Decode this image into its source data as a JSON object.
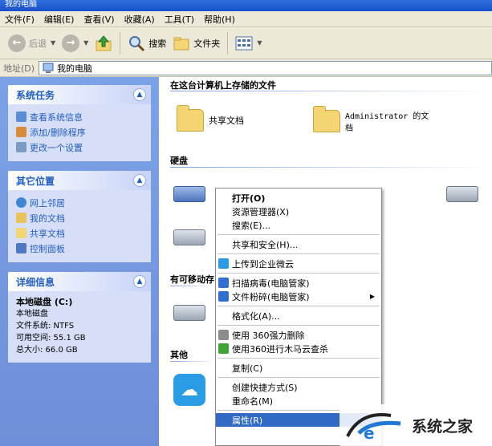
{
  "window": {
    "title": "我的电脑"
  },
  "menubar": [
    "文件(F)",
    "编辑(E)",
    "查看(V)",
    "收藏(A)",
    "工具(T)",
    "帮助(H)"
  ],
  "toolbar": {
    "back": "后退",
    "search": "搜索",
    "folders": "文件夹"
  },
  "address": {
    "label": "地址(D)",
    "value": "我的电脑"
  },
  "left": {
    "system_tasks": {
      "title": "系统任务",
      "items": [
        "查看系统信息",
        "添加/删除程序",
        "更改一个设置"
      ]
    },
    "other_places": {
      "title": "其它位置",
      "items": [
        "网上邻居",
        "我的文档",
        "共享文档",
        "控制面板"
      ]
    },
    "details": {
      "title": "详细信息",
      "name": "本地磁盘 (C:)",
      "type": "本地磁盘",
      "fs": "文件系统: NTFS",
      "free": "可用空间: 55.1 GB",
      "total": "总大小: 66.0 GB"
    }
  },
  "content": {
    "stored_files_header": "在这台计算机上存储的文件",
    "shared_docs": "共享文档",
    "admin_docs": "Administrator 的文档",
    "hard_disks_header": "硬盘",
    "partial_drive_label": ":)",
    "removable_header": "有可移动存",
    "other_header": "其他"
  },
  "context_menu": {
    "items": [
      {
        "label": "打开(O)",
        "bold": true
      },
      {
        "label": "资源管理器(X)"
      },
      {
        "label": "搜索(E)..."
      },
      {
        "sep": true
      },
      {
        "label": "共享和安全(H)..."
      },
      {
        "sep": true
      },
      {
        "label": "上传到企业微云",
        "icon": "cloud-icon"
      },
      {
        "sep": true
      },
      {
        "label": "扫描病毒(电脑管家)",
        "icon": "shield-icon"
      },
      {
        "label": "文件粉碎(电脑管家)",
        "icon": "shield-icon",
        "submenu": true
      },
      {
        "sep": true
      },
      {
        "label": "格式化(A)..."
      },
      {
        "sep": true
      },
      {
        "label": "使用 360强力删除",
        "icon": "trash-icon"
      },
      {
        "label": "使用360进行木马云查杀",
        "icon": "360-icon"
      },
      {
        "sep": true
      },
      {
        "label": "复制(C)"
      },
      {
        "sep": true
      },
      {
        "label": "创建快捷方式(S)"
      },
      {
        "label": "重命名(M)"
      },
      {
        "sep": true
      },
      {
        "label": "属性(R)",
        "selected": true
      }
    ]
  },
  "watermark": {
    "text": "系统之家"
  },
  "colors": {
    "selection": "#316ac5",
    "link": "#215dc6",
    "pane": "#7ba2e7"
  }
}
